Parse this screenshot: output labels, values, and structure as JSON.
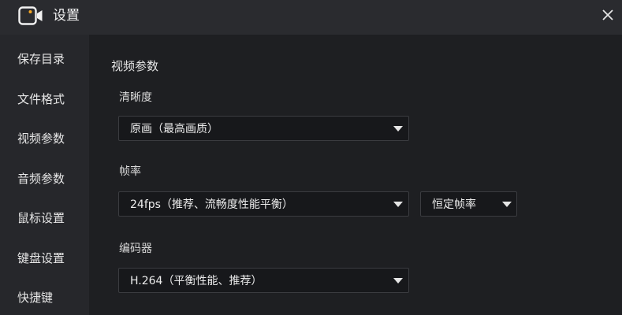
{
  "titlebar": {
    "title": "设置",
    "logo_icon": "camera-icon",
    "close_icon": "close-icon"
  },
  "sidebar": {
    "items": [
      {
        "label": "保存目录"
      },
      {
        "label": "文件格式"
      },
      {
        "label": "视频参数"
      },
      {
        "label": "音频参数"
      },
      {
        "label": "鼠标设置"
      },
      {
        "label": "键盘设置"
      },
      {
        "label": "快捷键"
      }
    ]
  },
  "main": {
    "section_title": "视频参数",
    "clarity": {
      "label": "清晰度",
      "value": "原画（最高画质）"
    },
    "framerate": {
      "label": "帧率",
      "value": "24fps（推荐、流畅度性能平衡）",
      "mode_value": "恒定帧率"
    },
    "encoder": {
      "label": "编码器",
      "value": "H.264（平衡性能、推荐）"
    }
  },
  "colors": {
    "background": "#1e1f22",
    "titlebar": "#2a2b2f",
    "sidebar": "#26272b",
    "select_bg": "#17181b"
  }
}
